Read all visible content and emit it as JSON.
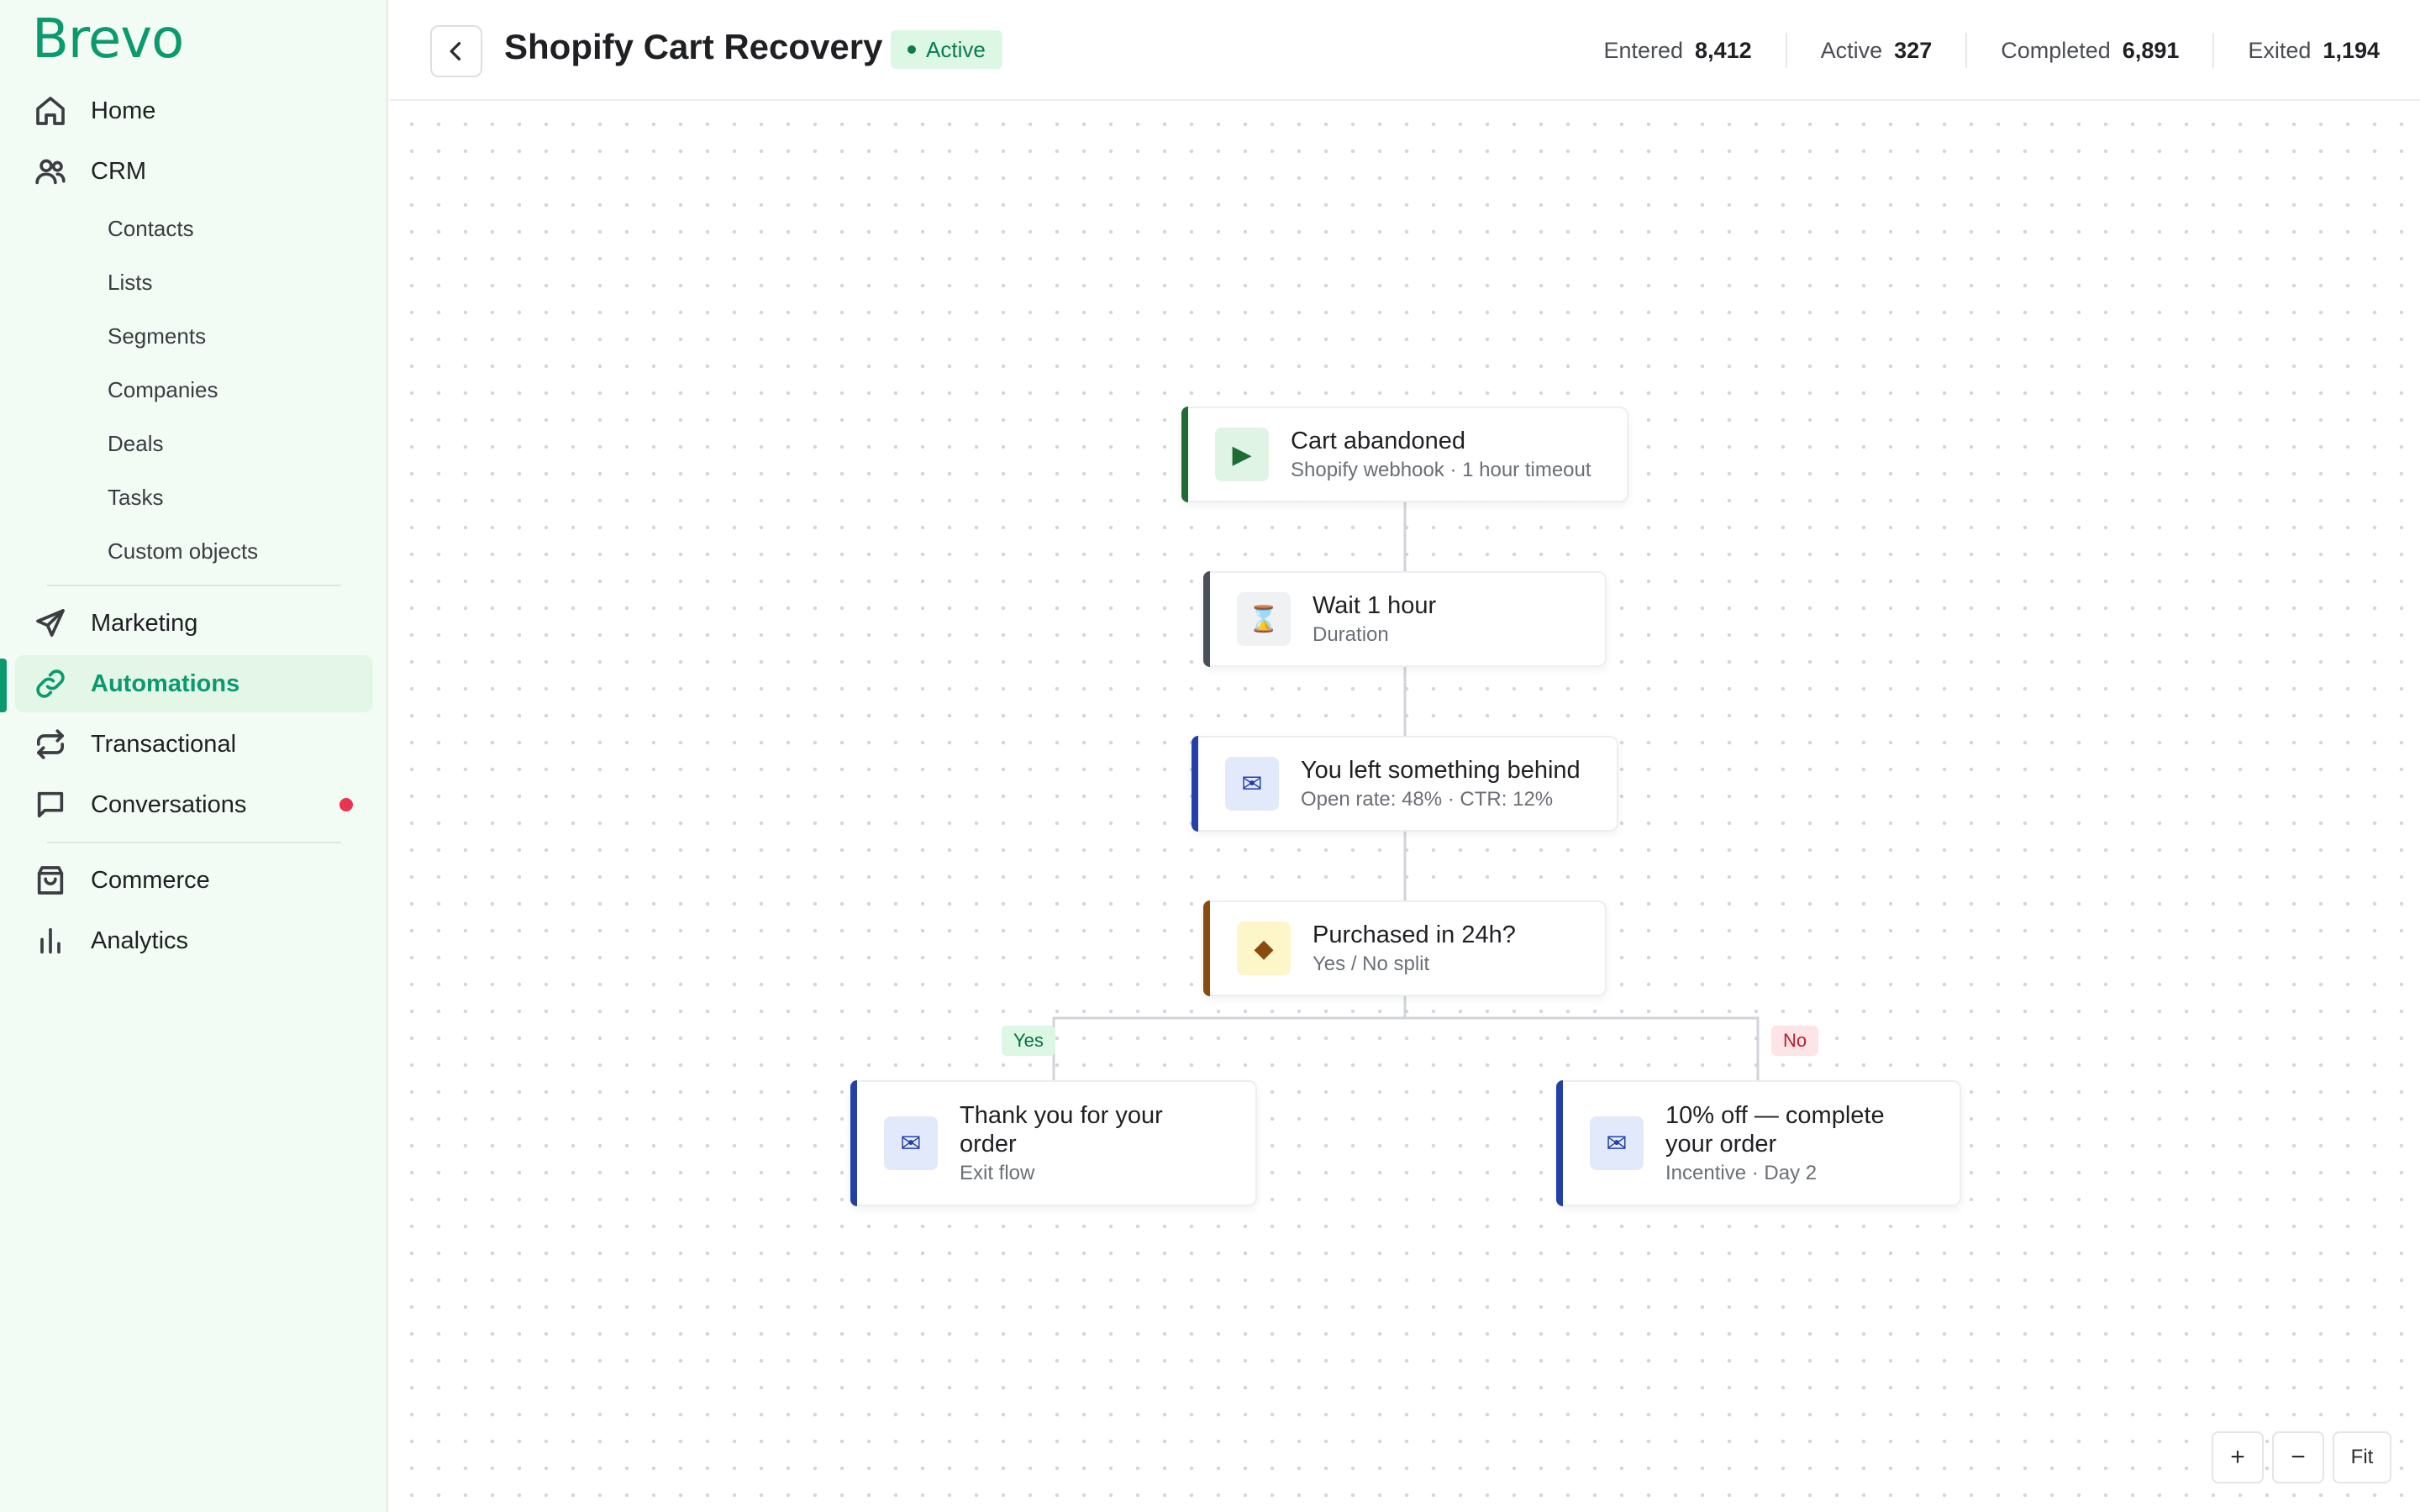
{
  "brand": {
    "logo": "Brevo"
  },
  "sidebar": {
    "items": [
      {
        "label": "Home"
      },
      {
        "label": "CRM"
      },
      {
        "label": "Marketing"
      },
      {
        "label": "Automations"
      },
      {
        "label": "Transactional"
      },
      {
        "label": "Conversations"
      },
      {
        "label": "Commerce"
      },
      {
        "label": "Analytics"
      }
    ],
    "crm_sub": [
      "Contacts",
      "Lists",
      "Segments",
      "Companies",
      "Deals",
      "Tasks",
      "Custom objects"
    ]
  },
  "header": {
    "title": "Shopify Cart Recovery",
    "status": "Active",
    "stats": [
      {
        "label": "Entered",
        "value": "8,412"
      },
      {
        "label": "Active",
        "value": "327"
      },
      {
        "label": "Completed",
        "value": "6,891"
      },
      {
        "label": "Exited",
        "value": "1,194"
      }
    ]
  },
  "flow": {
    "nodes": [
      {
        "title": "Cart abandoned",
        "subtitle": "Shopify webhook · 1 hour timeout",
        "icon": "play-icon",
        "glyph": "▶"
      },
      {
        "title": "Wait 1 hour",
        "subtitle": "Duration",
        "icon": "timer-icon",
        "glyph": "⌛"
      },
      {
        "title": "You left something behind",
        "subtitle": "Open rate: 48% · CTR: 12%",
        "icon": "email-icon",
        "glyph": "✉"
      },
      {
        "title": "Purchased in 24h?",
        "subtitle": "Yes / No split",
        "icon": "condition-diamond-icon",
        "glyph": "◆"
      },
      {
        "title": "Thank you for your order",
        "subtitle": "Exit flow",
        "icon": "email-icon",
        "glyph": "✉"
      },
      {
        "title": "10% off — complete your order",
        "subtitle": "Incentive · Day 2",
        "icon": "email-icon",
        "glyph": "✉"
      }
    ],
    "branches": {
      "yes": "Yes",
      "no": "No"
    }
  },
  "zoom": {
    "in": "+",
    "out": "−",
    "fit": "Fit"
  },
  "colors": {
    "brand": "#0b996e",
    "trigger": "#1f6b35",
    "wait": "#4a4f5c",
    "email": "#2340a8",
    "condition": "#8a4b0f",
    "alert": "#e8344e"
  }
}
